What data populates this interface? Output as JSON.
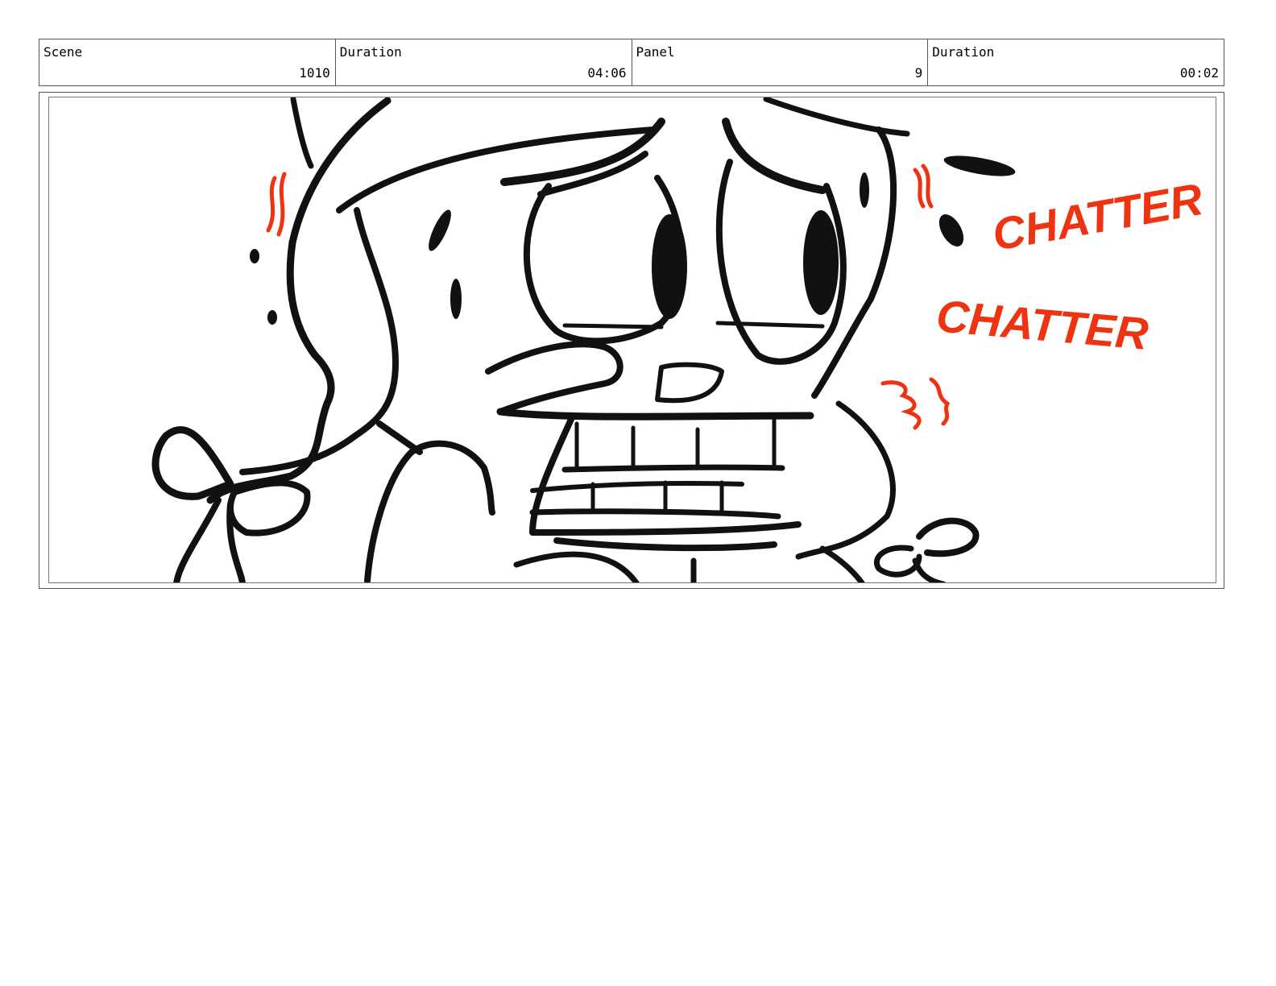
{
  "header": {
    "scene_label": "Scene",
    "scene_value": "1010",
    "scene_duration_label": "Duration",
    "scene_duration_value": "04:06",
    "panel_label": "Panel",
    "panel_value": "9",
    "panel_duration_label": "Duration",
    "panel_duration_value": "00:02"
  },
  "panel": {
    "sfx_1": "CHATTER",
    "sfx_2": "CHATTER"
  },
  "colors": {
    "ink": "#111111",
    "sfx_red": "#ee3311",
    "border": "#555555"
  }
}
